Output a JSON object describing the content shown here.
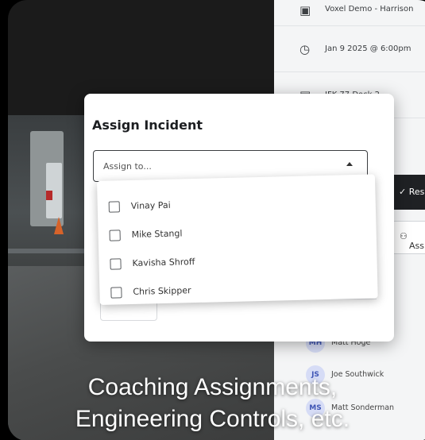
{
  "caption": {
    "line1": "Coaching Assignments,",
    "line2": "Engineering Controls, etc."
  },
  "panel": {
    "site": "Voxel Demo - Harrison",
    "datetime": "Jan 9 2025 @ 6:00pm",
    "camera": "JFK 77 Dock 2",
    "resolve_label": "✓ Reso",
    "assign_label": "Assi",
    "assignees": [
      {
        "initials": "MH",
        "name": "Matt Hoge"
      },
      {
        "initials": "JS",
        "name": "Joe Southwick"
      },
      {
        "initials": "MS",
        "name": "Matt Sonderman"
      }
    ]
  },
  "modal": {
    "title": "Assign Incident",
    "select_placeholder": "Assign to...",
    "options": [
      {
        "label": "Vinay Pai",
        "checked": false
      },
      {
        "label": "Mike Stangl",
        "checked": false
      },
      {
        "label": "Kavisha Shroff",
        "checked": false
      },
      {
        "label": "Chris Skipper",
        "checked": false
      }
    ]
  },
  "colors": {
    "resolve_bg": "#1f2124",
    "avatar_bg": "#d6dcf6",
    "avatar_text": "#3f55b5"
  }
}
